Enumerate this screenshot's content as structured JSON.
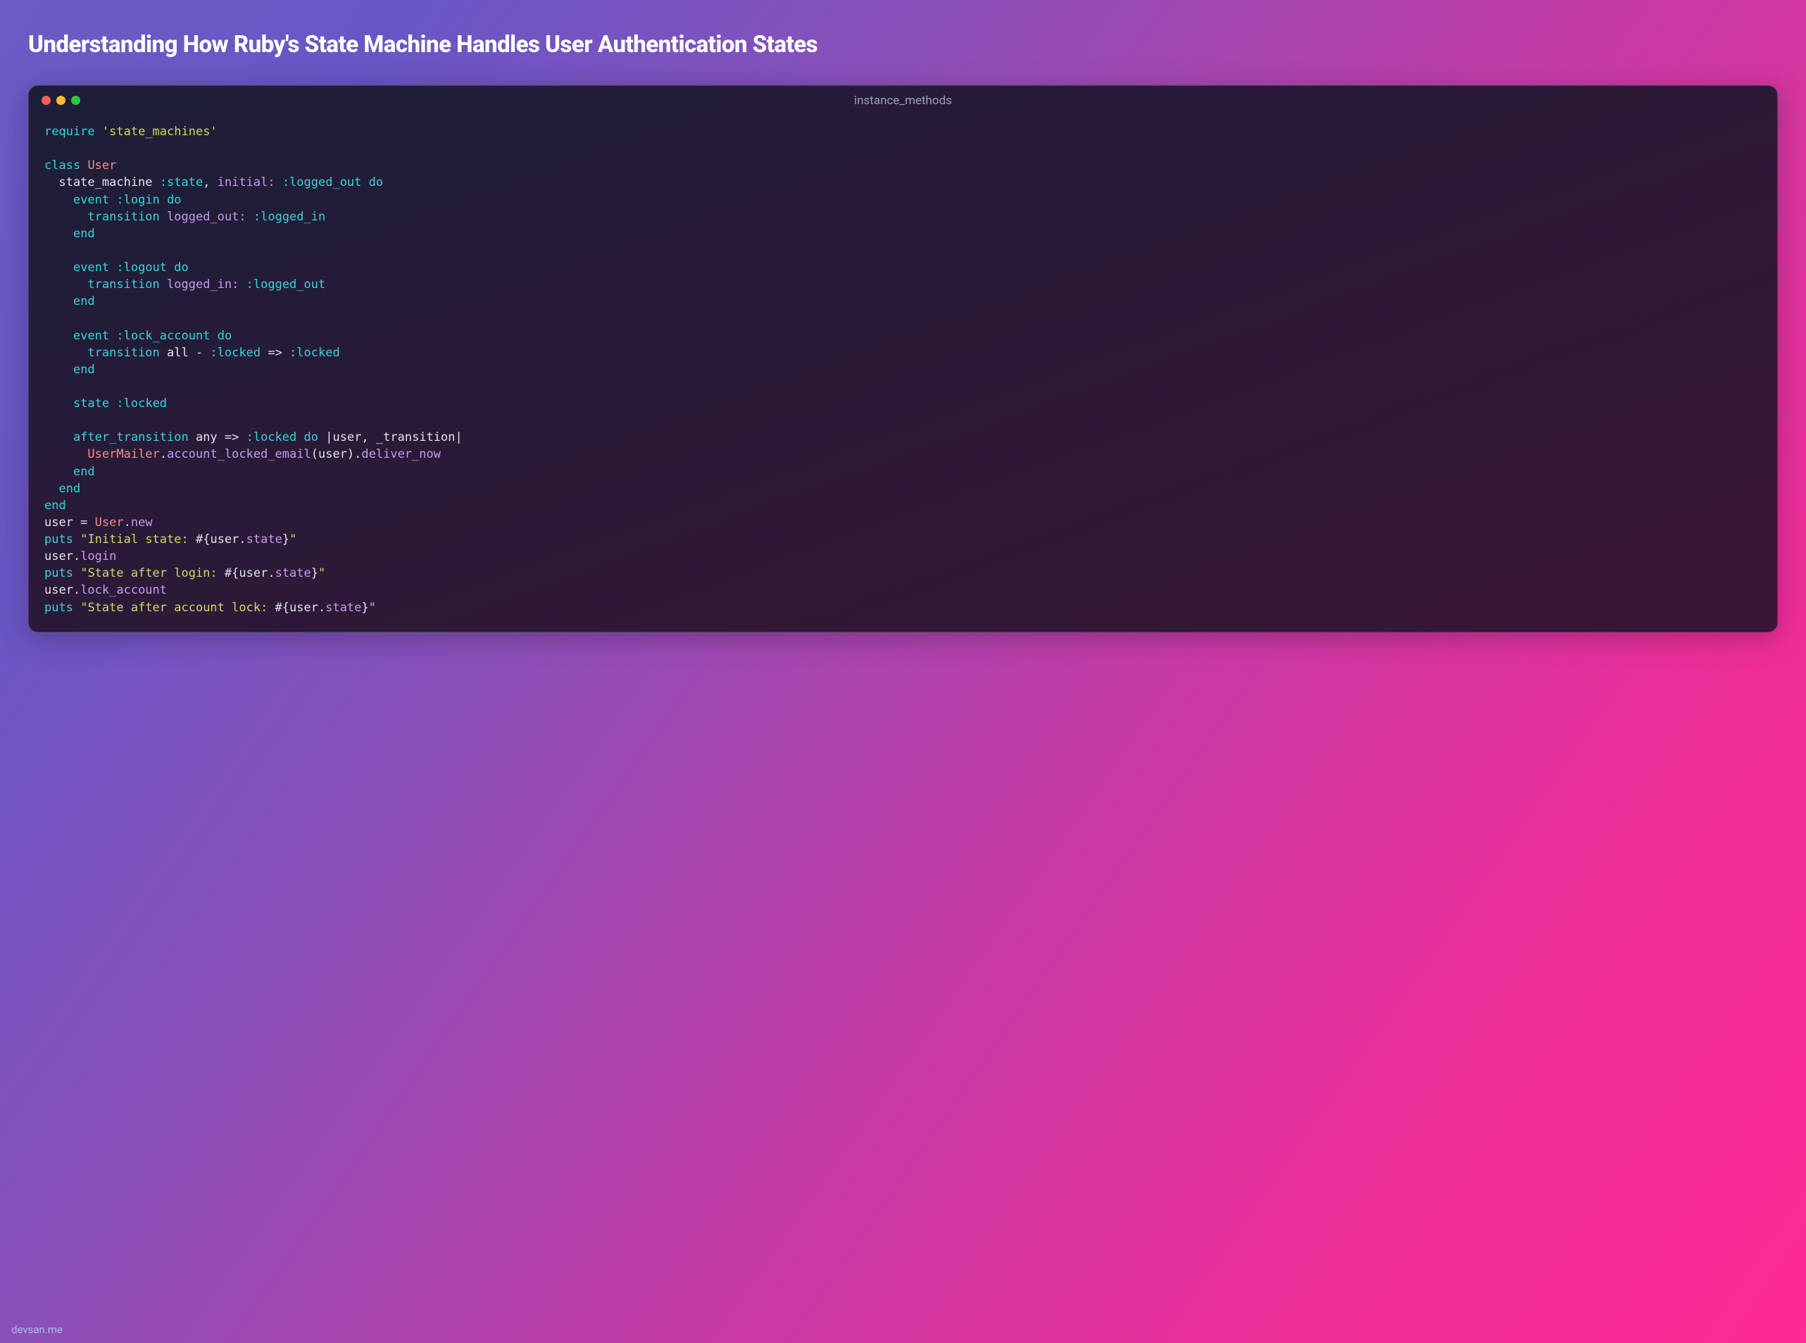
{
  "page": {
    "title": "Understanding How Ruby's State Machine Handles User Authentication States",
    "watermark": "devsan.me"
  },
  "window": {
    "title": "instance_methods",
    "traffic_lights": [
      "close",
      "minimize",
      "zoom"
    ]
  },
  "code": {
    "lines": [
      [
        [
          "kw",
          "require"
        ],
        [
          "plain",
          " "
        ],
        [
          "str",
          "'state_machines'"
        ]
      ],
      [],
      [
        [
          "kw",
          "class"
        ],
        [
          "plain",
          " "
        ],
        [
          "cls",
          "User"
        ]
      ],
      [
        [
          "plain",
          "  state_machine "
        ],
        [
          "sym",
          ":state"
        ],
        [
          "plain",
          ", "
        ],
        [
          "lbl",
          "initial:"
        ],
        [
          "plain",
          " "
        ],
        [
          "sym",
          ":logged_out"
        ],
        [
          "plain",
          " "
        ],
        [
          "kw",
          "do"
        ]
      ],
      [
        [
          "plain",
          "    "
        ],
        [
          "fn",
          "event"
        ],
        [
          "plain",
          " "
        ],
        [
          "sym",
          ":login"
        ],
        [
          "plain",
          " "
        ],
        [
          "kw",
          "do"
        ]
      ],
      [
        [
          "plain",
          "      "
        ],
        [
          "fn",
          "transition"
        ],
        [
          "plain",
          " "
        ],
        [
          "lbl",
          "logged_out:"
        ],
        [
          "plain",
          " "
        ],
        [
          "sym",
          ":logged_in"
        ]
      ],
      [
        [
          "plain",
          "    "
        ],
        [
          "kw",
          "end"
        ]
      ],
      [],
      [
        [
          "plain",
          "    "
        ],
        [
          "fn",
          "event"
        ],
        [
          "plain",
          " "
        ],
        [
          "sym",
          ":logout"
        ],
        [
          "plain",
          " "
        ],
        [
          "kw",
          "do"
        ]
      ],
      [
        [
          "plain",
          "      "
        ],
        [
          "fn",
          "transition"
        ],
        [
          "plain",
          " "
        ],
        [
          "lbl",
          "logged_in:"
        ],
        [
          "plain",
          " "
        ],
        [
          "sym",
          ":logged_out"
        ]
      ],
      [
        [
          "plain",
          "    "
        ],
        [
          "kw",
          "end"
        ]
      ],
      [],
      [
        [
          "plain",
          "    "
        ],
        [
          "fn",
          "event"
        ],
        [
          "plain",
          " "
        ],
        [
          "sym",
          ":lock_account"
        ],
        [
          "plain",
          " "
        ],
        [
          "kw",
          "do"
        ]
      ],
      [
        [
          "plain",
          "      "
        ],
        [
          "fn",
          "transition"
        ],
        [
          "plain",
          " all - "
        ],
        [
          "sym",
          ":locked"
        ],
        [
          "plain",
          " => "
        ],
        [
          "sym",
          ":locked"
        ]
      ],
      [
        [
          "plain",
          "    "
        ],
        [
          "kw",
          "end"
        ]
      ],
      [],
      [
        [
          "plain",
          "    "
        ],
        [
          "fn",
          "state"
        ],
        [
          "plain",
          " "
        ],
        [
          "sym",
          ":locked"
        ]
      ],
      [],
      [
        [
          "plain",
          "    "
        ],
        [
          "fn",
          "after_transition"
        ],
        [
          "plain",
          " any => "
        ],
        [
          "sym",
          ":locked"
        ],
        [
          "plain",
          " "
        ],
        [
          "kw",
          "do"
        ],
        [
          "plain",
          " "
        ],
        [
          "pipe",
          "|"
        ],
        [
          "plain",
          "user, _transition"
        ],
        [
          "pipe",
          "|"
        ]
      ],
      [
        [
          "plain",
          "      "
        ],
        [
          "cls",
          "UserMailer"
        ],
        [
          "plain",
          "."
        ],
        [
          "meth",
          "account_locked_email"
        ],
        [
          "plain",
          "(user)."
        ],
        [
          "meth",
          "deliver_now"
        ]
      ],
      [
        [
          "plain",
          "    "
        ],
        [
          "kw",
          "end"
        ]
      ],
      [
        [
          "plain",
          "  "
        ],
        [
          "kw",
          "end"
        ]
      ],
      [
        [
          "kw",
          "end"
        ]
      ],
      [
        [
          "plain",
          "user = "
        ],
        [
          "cls",
          "User"
        ],
        [
          "plain",
          "."
        ],
        [
          "meth",
          "new"
        ]
      ],
      [
        [
          "kw",
          "puts"
        ],
        [
          "plain",
          " "
        ],
        [
          "str",
          "\"Initial state: "
        ],
        [
          "plain",
          "#{"
        ],
        [
          "plain",
          "user."
        ],
        [
          "meth",
          "state"
        ],
        [
          "plain",
          "}"
        ],
        [
          "str",
          "\""
        ]
      ],
      [
        [
          "plain",
          "user."
        ],
        [
          "meth",
          "login"
        ]
      ],
      [
        [
          "kw",
          "puts"
        ],
        [
          "plain",
          " "
        ],
        [
          "str",
          "\"State after login: "
        ],
        [
          "plain",
          "#{"
        ],
        [
          "plain",
          "user."
        ],
        [
          "meth",
          "state"
        ],
        [
          "plain",
          "}"
        ],
        [
          "str",
          "\""
        ]
      ],
      [
        [
          "plain",
          "user."
        ],
        [
          "meth",
          "lock_account"
        ]
      ],
      [
        [
          "kw",
          "puts"
        ],
        [
          "plain",
          " "
        ],
        [
          "str",
          "\"State after account lock: "
        ],
        [
          "plain",
          "#{"
        ],
        [
          "plain",
          "user."
        ],
        [
          "meth",
          "state"
        ],
        [
          "plain",
          "}"
        ],
        [
          "str",
          "\""
        ]
      ]
    ]
  }
}
